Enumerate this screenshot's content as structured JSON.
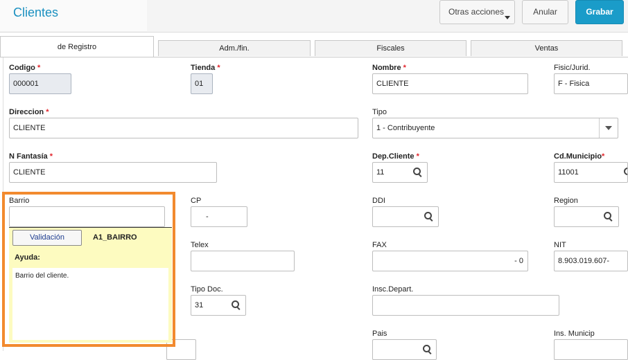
{
  "header": {
    "title": "Clientes",
    "other_actions_label": "Otras acciones",
    "cancel_label": "Anular",
    "save_label": "Grabar"
  },
  "tabs": [
    {
      "label": "de Registro",
      "active": true
    },
    {
      "label": "Adm./fin.",
      "active": false
    },
    {
      "label": "Fiscales",
      "active": false
    },
    {
      "label": "Ventas",
      "active": false
    }
  ],
  "form": {
    "codigo": {
      "label": "Codigo",
      "value": "000001"
    },
    "tienda": {
      "label": "Tienda",
      "value": "01"
    },
    "nombre": {
      "label": "Nombre",
      "value": "CLIENTE"
    },
    "fisic": {
      "label": "Fisic/Jurid.",
      "value": "F - Fisica"
    },
    "direccion": {
      "label": "Direccion",
      "value": "CLIENTE"
    },
    "tipo": {
      "label": "Tipo",
      "value": "1 - Contribuyente"
    },
    "fantasia": {
      "label": "N Fantasía",
      "value": "CLIENTE"
    },
    "dep_cliente": {
      "label": "Dep.Cliente",
      "value": "11"
    },
    "cd_municipio": {
      "label": "Cd.Municipio",
      "value": "11001"
    },
    "barrio": {
      "label": "Barrio",
      "value": ""
    },
    "cp": {
      "label": "CP",
      "value": "-"
    },
    "ddi": {
      "label": "DDI",
      "value": ""
    },
    "region": {
      "label": "Region",
      "value": ""
    },
    "telex": {
      "label": "Telex",
      "value": ""
    },
    "fax": {
      "label": "FAX",
      "value": "-  0"
    },
    "nit": {
      "label": "NIT",
      "value": "8.903.019.607-"
    },
    "tipo_doc": {
      "label": "Tipo Doc.",
      "value": "31"
    },
    "insc_depart": {
      "label": "Insc.Depart.",
      "value": ""
    },
    "pais": {
      "label": "Pais",
      "value": ""
    },
    "ins_municip": {
      "label": "Ins. Municip",
      "value": ""
    },
    "required_mark": "*"
  },
  "help_popup": {
    "validation_label": "Validación",
    "field_code": "A1_BAIRRO",
    "help_title": "Ayuda:",
    "help_text": "Barrio del cliente."
  }
}
